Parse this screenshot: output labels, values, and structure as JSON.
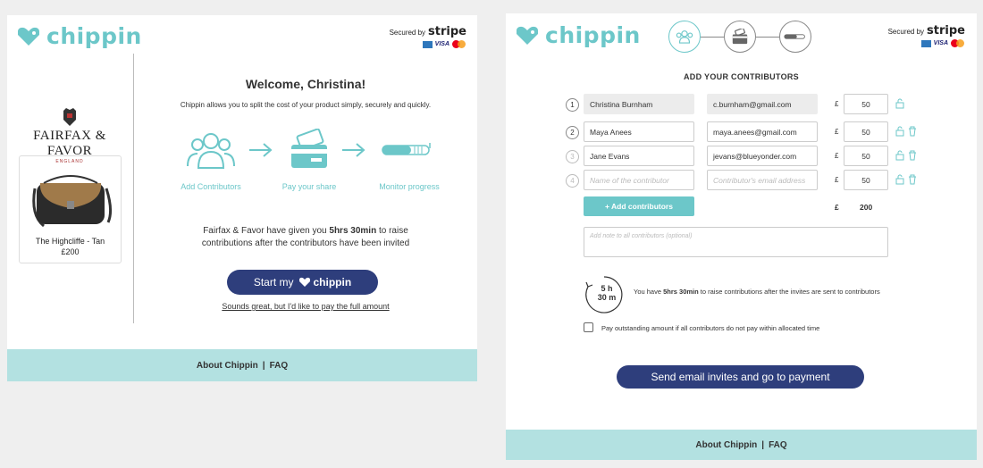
{
  "brand": {
    "name": "chippin",
    "accent": "#6cc7c9",
    "navy": "#2e3e7c",
    "footer_bg": "#b3e1e1"
  },
  "secure": {
    "label": "Secured by",
    "provider": "stripe",
    "cards": [
      "VISA"
    ]
  },
  "left": {
    "welcome": "Welcome, Christina!",
    "intro": "Chippin allows you to split the cost of your product simply, securely and quickly.",
    "merchant": {
      "name": "FAIRFAX & FAVOR",
      "sub": "ENGLAND"
    },
    "product": {
      "name": "The Highcliffe - Tan",
      "price": "£200"
    },
    "steps": [
      "Add Contributors",
      "Pay your share",
      "Monitor progress"
    ],
    "deadline_pre": "Fairfax & Favor have given you ",
    "deadline_bold": "5hrs 30min",
    "deadline_post": " to raise",
    "deadline_line2": "contributions after the contributors have been invited",
    "start_label": "Start my",
    "start_brand": "chippin",
    "full_pay_link": "Sounds great, but I'd like to pay the full amount",
    "footer": {
      "about": "About Chippin",
      "sep": "|",
      "faq": "FAQ"
    }
  },
  "right": {
    "heading": "ADD YOUR CONTRIBUTORS",
    "currency": "£",
    "contributors": [
      {
        "num": "1",
        "name": "Christina Burnham",
        "email": "c.burnham@gmail.com",
        "amount": "50"
      },
      {
        "num": "2",
        "name": "Maya Anees",
        "email": "maya.anees@gmail.com",
        "amount": "50"
      },
      {
        "num": "3",
        "name": "Jane Evans",
        "email": "jevans@blueyonder.com",
        "amount": "50"
      }
    ],
    "empty_row": {
      "num": "4",
      "name_placeholder": "Name of the contributor",
      "email_placeholder": "Contributor's email address",
      "amount": "50"
    },
    "add_button": "+ Add contributors",
    "total": "200",
    "note_placeholder": "Add note to all contributors (optional)",
    "timer": {
      "hours": "5 h",
      "minutes": "30 m"
    },
    "timer_msg_pre": "You have ",
    "timer_msg_bold": "5hrs 30min",
    "timer_msg_post": " to raise contributions after the invites are sent to contributors",
    "checkbox_label": "Pay outstanding amount if all contributors do not pay within allocated time",
    "submit": "Send email invites and go to payment",
    "footer": {
      "about": "About Chippin",
      "sep": "|",
      "faq": "FAQ"
    }
  }
}
